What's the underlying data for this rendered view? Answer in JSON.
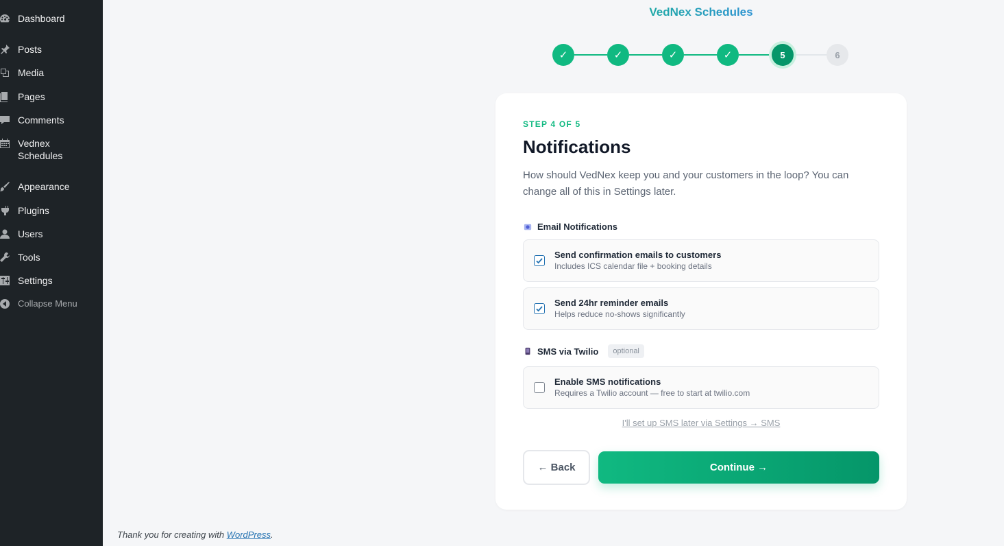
{
  "sidebar": {
    "items": [
      {
        "label": "Dashboard",
        "icon": "dashboard-icon"
      },
      {
        "label": "Posts",
        "icon": "pin-icon"
      },
      {
        "label": "Media",
        "icon": "media-icon"
      },
      {
        "label": "Pages",
        "icon": "pages-icon"
      },
      {
        "label": "Comments",
        "icon": "comment-icon"
      },
      {
        "label": "Vednex Schedules",
        "icon": "calendar-icon"
      },
      {
        "label": "Appearance",
        "icon": "brush-icon"
      },
      {
        "label": "Plugins",
        "icon": "plugin-icon"
      },
      {
        "label": "Users",
        "icon": "user-icon"
      },
      {
        "label": "Tools",
        "icon": "wrench-icon"
      },
      {
        "label": "Settings",
        "icon": "sliders-icon"
      }
    ],
    "collapse_label": "Collapse Menu"
  },
  "wizard": {
    "brand": "VedNex Schedules",
    "steps": [
      {
        "label": "✓",
        "state": "done"
      },
      {
        "label": "✓",
        "state": "done"
      },
      {
        "label": "✓",
        "state": "done"
      },
      {
        "label": "✓",
        "state": "done"
      },
      {
        "label": "5",
        "state": "current"
      },
      {
        "label": "6",
        "state": "pending"
      }
    ],
    "step_label": "STEP 4 OF 5",
    "title": "Notifications",
    "description": "How should VedNex keep you and your customers in the loop? You can change all of this in Settings later.",
    "email_section": {
      "title": "Email Notifications",
      "options": [
        {
          "title": "Send confirmation emails to customers",
          "subtitle": "Includes ICS calendar file + booking details",
          "checked": true
        },
        {
          "title": "Send 24hr reminder emails",
          "subtitle": "Helps reduce no-shows significantly",
          "checked": true
        }
      ]
    },
    "sms_section": {
      "title": "SMS via Twilio",
      "badge": "optional",
      "option": {
        "title": "Enable SMS notifications",
        "subtitle": "Requires a Twilio account — free to start at twilio.com",
        "checked": false
      }
    },
    "skip_link": "I'll set up SMS later via Settings → SMS",
    "back_label": "← Back",
    "continue_label": "Continue →"
  },
  "footer": {
    "prefix": "Thank you for creating with ",
    "link": "WordPress",
    "suffix": "."
  },
  "colors": {
    "accent": "#10b981",
    "accent_dark": "#059669",
    "sidebar_bg": "#1e2327",
    "link": "#2271b1"
  }
}
